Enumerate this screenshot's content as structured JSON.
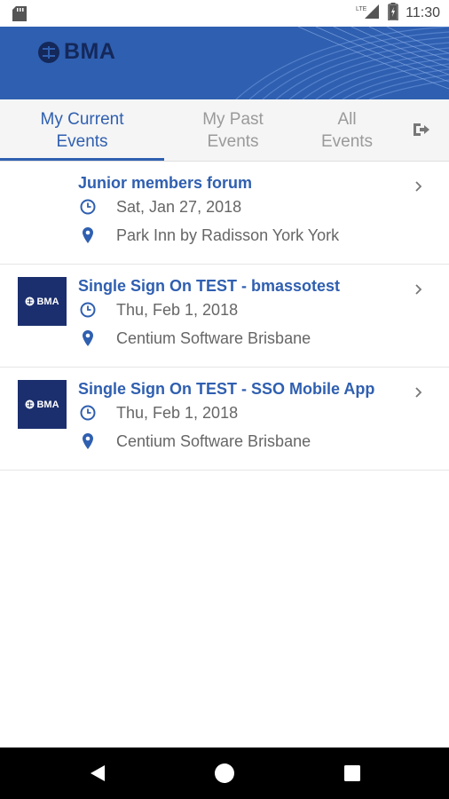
{
  "status_bar": {
    "network": "LTE",
    "time": "11:30"
  },
  "header": {
    "logo_text": "BMA",
    "brand_color": "#2f5fb0"
  },
  "tabs": [
    {
      "label": "My Current Events",
      "line1": "My Current",
      "line2": "Events",
      "active": true
    },
    {
      "label": "My Past Events",
      "line1": "My Past",
      "line2": "Events",
      "active": false
    },
    {
      "label": "All Events",
      "line1": "All",
      "line2": "Events",
      "active": false
    }
  ],
  "logout_icon": "logout-icon",
  "events": [
    {
      "title": "Junior members forum",
      "date": "Sat, Jan 27, 2018",
      "location": "Park Inn by Radisson York York",
      "has_thumbnail": false
    },
    {
      "title": "Single Sign On TEST - bmassotest",
      "date": "Thu, Feb 1, 2018",
      "location": "Centium Software Brisbane",
      "has_thumbnail": true,
      "thumbnail_text": "BMA"
    },
    {
      "title": "Single Sign On TEST - SSO Mobile App",
      "date": "Thu, Feb 1, 2018",
      "location": "Centium Software Brisbane",
      "has_thumbnail": true,
      "thumbnail_text": "BMA"
    }
  ],
  "nav_bar": {
    "back": "back-icon",
    "home": "home-icon",
    "recents": "recents-icon"
  }
}
